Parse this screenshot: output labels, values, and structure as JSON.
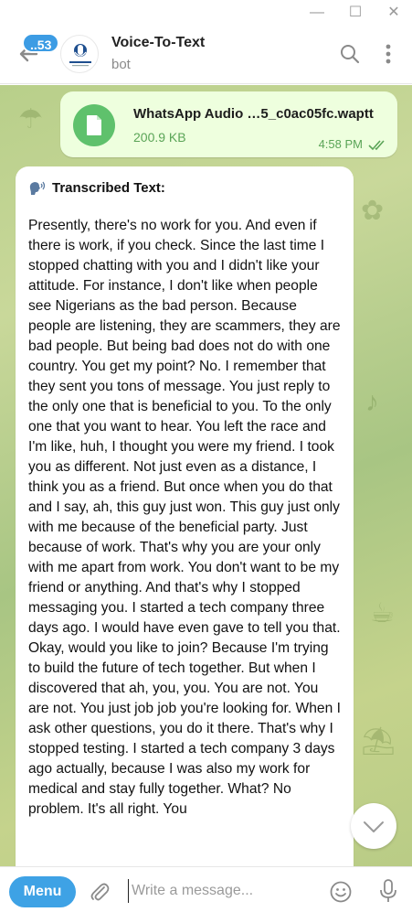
{
  "window": {
    "minimize": "—",
    "maximize": "☐",
    "close": "✕"
  },
  "header": {
    "unread_count": "53",
    "title": "Voice-To-Text",
    "subtitle": "bot"
  },
  "outgoing": {
    "file_name": "WhatsApp Audio  …5_c0ac05fc.waptt",
    "file_size": "200.9 KB",
    "time": "4:58 PM"
  },
  "incoming": {
    "heading": "Transcribed Text:",
    "body": "Presently, there's no work for you. And even if there is work, if you check. Since the last time I stopped chatting with you and I didn't like your attitude. For instance, I don't like when people see Nigerians as the bad person. Because people are listening, they are scammers, they are bad people. But being bad does not do with one country. You get my point? No. I remember that they sent you tons of message. You just reply to the only one that is beneficial to you. To the only one that you want to hear. You left the race and I'm like, huh, I thought you were my friend. I took you as different. Not just even as a distance, I think you as a friend. But once when you do that and I say, ah, this guy just won. This guy just only with me because of the beneficial party. Just because of work. That's why you are your only with me apart from work. You don't want to be my friend or anything. And that's why I stopped messaging you. I started a tech company three days ago. I would have even gave to tell you that. Okay, would you like to join? Because I'm trying to build the future of tech together. But when I discovered that ah, you, you. You are not. You are not. You just job job you're looking for. When I ask other questions, you do it there. That's why I stopped testing. I started a tech company 3 days ago actually, because I was also my work for medical and stay fully together. What? No problem. It's all right. You"
  },
  "composer": {
    "menu_label": "Menu",
    "placeholder": "Write a message..."
  },
  "icons": {
    "back": "arrow-left-icon",
    "search": "search-icon",
    "more": "more-vertical-icon",
    "file": "document-icon",
    "read": "double-check-icon",
    "speaker": "speaking-head-icon",
    "scroll": "chevron-down-icon",
    "attach": "paperclip-icon",
    "emoji": "emoji-icon",
    "mic": "microphone-icon"
  },
  "colors": {
    "accent": "#3ea2e5",
    "file_icon": "#5fc16c",
    "out_bubble": "#eeffde",
    "out_meta": "#5aa457"
  }
}
